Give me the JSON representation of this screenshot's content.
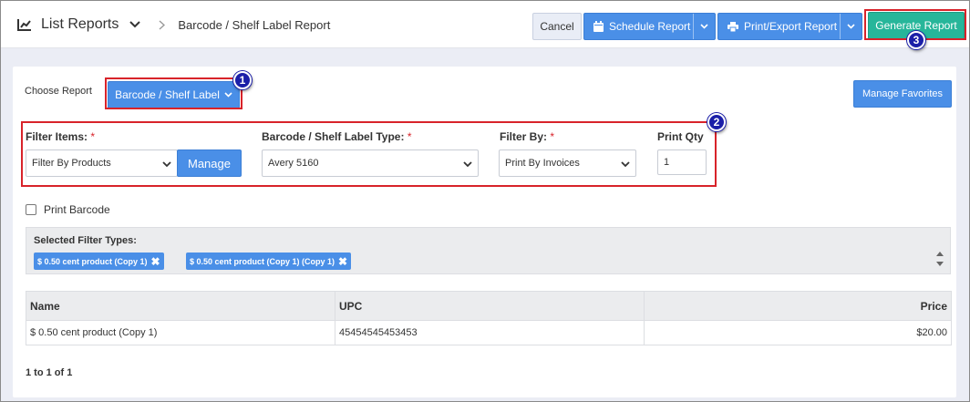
{
  "header": {
    "title": "List Reports",
    "breadcrumb": "Barcode / Shelf Label Report",
    "cancel_label": "Cancel",
    "schedule_label": "Schedule Report",
    "print_label": "Print/Export Report",
    "generate_label": "Generate Report"
  },
  "report": {
    "choose_label": "Choose Report",
    "selected": "Barcode / Shelf Label",
    "favorites_label": "Manage Favorites"
  },
  "filters": {
    "items_label": "Filter Items:",
    "items_value": "Filter By Products",
    "manage_label": "Manage",
    "type_label": "Barcode / Shelf Label Type:",
    "type_value": "Avery 5160",
    "filter_by_label": "Filter By:",
    "filter_by_value": "Print By Invoices",
    "qty_label": "Print Qty",
    "qty_value": "1",
    "required_mark": "*"
  },
  "print_barcode_label": "Print Barcode",
  "selected_filters": {
    "title": "Selected Filter Types:",
    "tags": [
      "$ 0.50 cent product (Copy 1)",
      "$ 0.50 cent product (Copy 1) (Copy 1)"
    ],
    "remove_glyph": "✖"
  },
  "table": {
    "columns": [
      "Name",
      "UPC",
      "Price"
    ],
    "rows": [
      [
        "$ 0.50 cent product (Copy 1)",
        "45454545453453",
        "$20.00"
      ]
    ]
  },
  "pager": "1 to 1 of 1",
  "badges": [
    "1",
    "2",
    "3"
  ],
  "colors": {
    "accent": "#4a8fe7",
    "generate": "#27b69a",
    "highlight": "#d8232a",
    "badge": "#1b1fa8"
  }
}
